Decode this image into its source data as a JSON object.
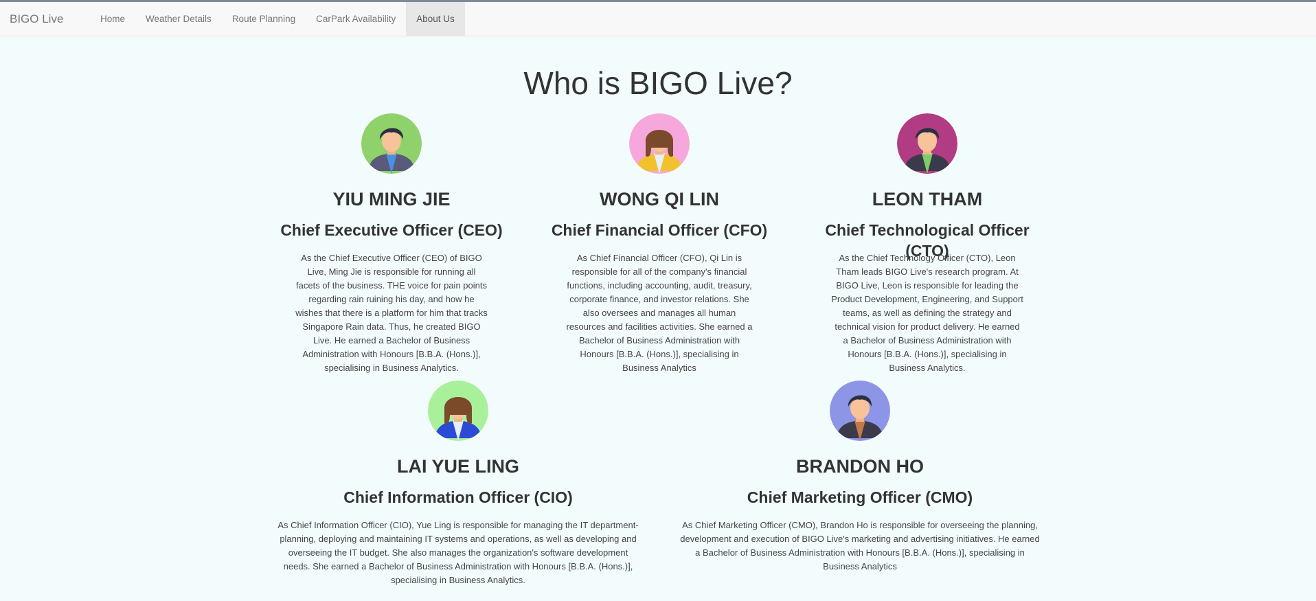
{
  "navbar": {
    "brand": "BIGO Live",
    "items": [
      {
        "label": "Home",
        "active": false
      },
      {
        "label": "Weather Details",
        "active": false
      },
      {
        "label": "Route Planning",
        "active": false
      },
      {
        "label": "CarPark Availability",
        "active": false
      },
      {
        "label": "About Us",
        "active": true
      }
    ]
  },
  "page": {
    "title": "Who is BIGO Live?"
  },
  "team": [
    {
      "name": "YIU MING JIE",
      "role": "Chief Executive Officer (CEO)",
      "bio": "As the Chief Executive Officer (CEO) of BIGO Live, Ming Jie is responsible for running all facets of the business. THE voice for pain points regarding rain ruining his day, and how he wishes that there is a platform for him that tracks Singapore Rain data. Thus, he created BIGO Live. He earned a Bachelor of Business Administration with Honours [B.B.A. (Hons.)], specialising in Business Analytics.",
      "avatar": {
        "icon": "man-avatar-icon",
        "bg": "#8fd16a",
        "hair": "#2c2f3f",
        "jacket": "#5a5a7a",
        "shirt": "#4a90e2"
      }
    },
    {
      "name": "WONG QI LIN",
      "role": "Chief Financial Officer (CFO)",
      "bio": "As Chief Financial Officer (CFO), Qi Lin is responsible for all of the company's financial functions, including accounting, audit, treasury, corporate finance, and investor relations. She also oversees and manages all human resources and facilities activities. She earned a Bachelor of Business Administration with Honours [B.B.A. (Hons.)], specialising in Business Analytics",
      "avatar": {
        "icon": "woman-avatar-icon",
        "bg": "#f6a8dc",
        "hair": "#7a4a2a",
        "jacket": "#f2c12e",
        "shirt": "#e6f0fa"
      }
    },
    {
      "name": "LEON THAM",
      "role": "Chief Technological Officer (CTO)",
      "bio": "As the Chief Technology Officer (CTO), Leon Tham leads BIGO Live's research program. At BIGO Live, Leon is responsible for leading the Product Development, Engineering, and Support teams, as well as defining the strategy and technical vision for product delivery. He earned a Bachelor of Business Administration with Honours [B.B.A. (Hons.)], specialising in Business Analytics.",
      "avatar": {
        "icon": "man-avatar-icon",
        "bg": "#b13c84",
        "hair": "#2c2f3f",
        "jacket": "#3a3a4a",
        "shirt": "#7ccc6a"
      }
    },
    {
      "name": "LAI YUE LING",
      "role": "Chief Information Officer (CIO)",
      "bio": "As Chief Information Officer (CIO), Yue Ling is responsible for managing the IT department-planning, deploying and maintaining IT systems and operations, as well as developing and overseeing the IT budget. She also manages the organization's software development needs. She earned a Bachelor of Business Administration with Honours [B.B.A. (Hons.)], specialising in Business Analytics.",
      "avatar": {
        "icon": "woman-avatar-icon",
        "bg": "#a9f09a",
        "hair": "#7a4a2a",
        "jacket": "#2b4bd6",
        "shirt": "#e6f0fa"
      }
    },
    {
      "name": "BRANDON HO",
      "role": "Chief Marketing Officer (CMO)",
      "bio": "As Chief Marketing Officer (CMO), Brandon Ho is responsible for overseeing the planning, development and execution of BIGO Live's marketing and advertising initiatives. He earned a Bachelor of Business Administration with Honours [B.B.A. (Hons.)], specialising in Business Analytics",
      "avatar": {
        "icon": "man-avatar-icon",
        "bg": "#8c95e6",
        "hair": "#2c2f3f",
        "jacket": "#3a3a4a",
        "shirt": "#c27a4a"
      }
    }
  ]
}
